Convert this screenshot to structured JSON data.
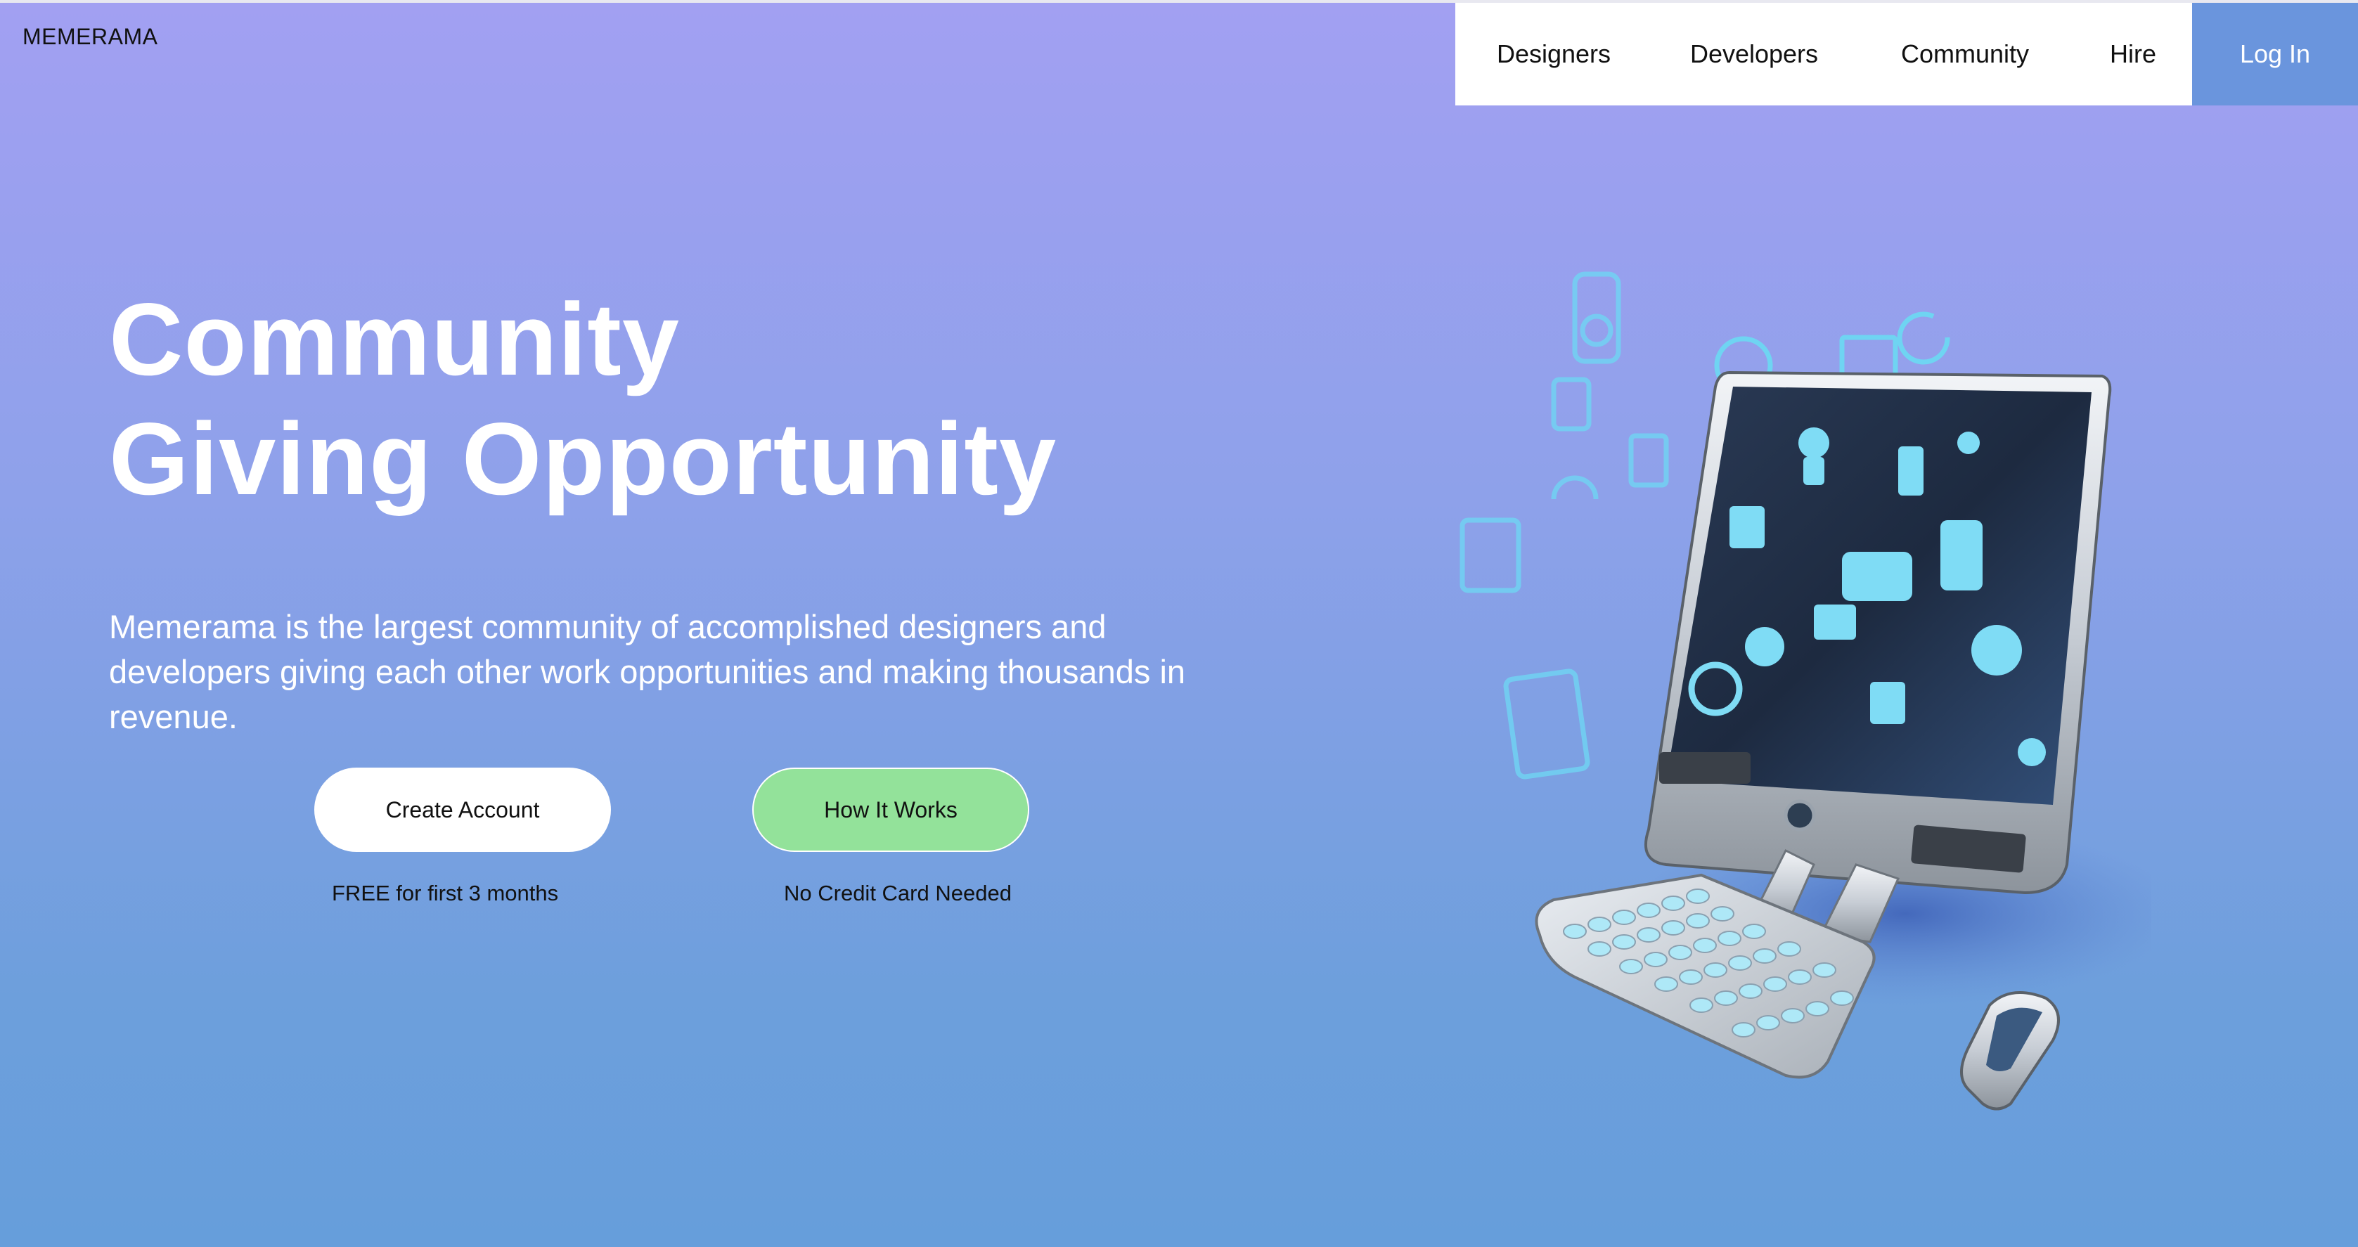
{
  "header": {
    "brand": "MEMERAMA",
    "nav": [
      {
        "label": "Designers"
      },
      {
        "label": "Developers"
      },
      {
        "label": "Community"
      },
      {
        "label": "Hire"
      },
      {
        "label": "Log In"
      }
    ]
  },
  "hero": {
    "title_line1": "Community",
    "title_line2": "Giving Opportunity",
    "description": "Memerama is the largest community of accomplished designers and developers giving each other work opportunities and making thousands in revenue.",
    "primary_button": "Create Account",
    "primary_caption": "FREE for first 3 months",
    "secondary_button": "How It Works",
    "secondary_caption": "No Credit Card Needed"
  },
  "colors": {
    "gradient_top": "#a2a0f2",
    "gradient_bottom": "#669edb",
    "login_accent": "#6a95dd",
    "how_it_works_green": "#93e29a",
    "icon_cyan": "#6fd4f2"
  },
  "illustration": {
    "icon": "computer-with-app-icons"
  }
}
